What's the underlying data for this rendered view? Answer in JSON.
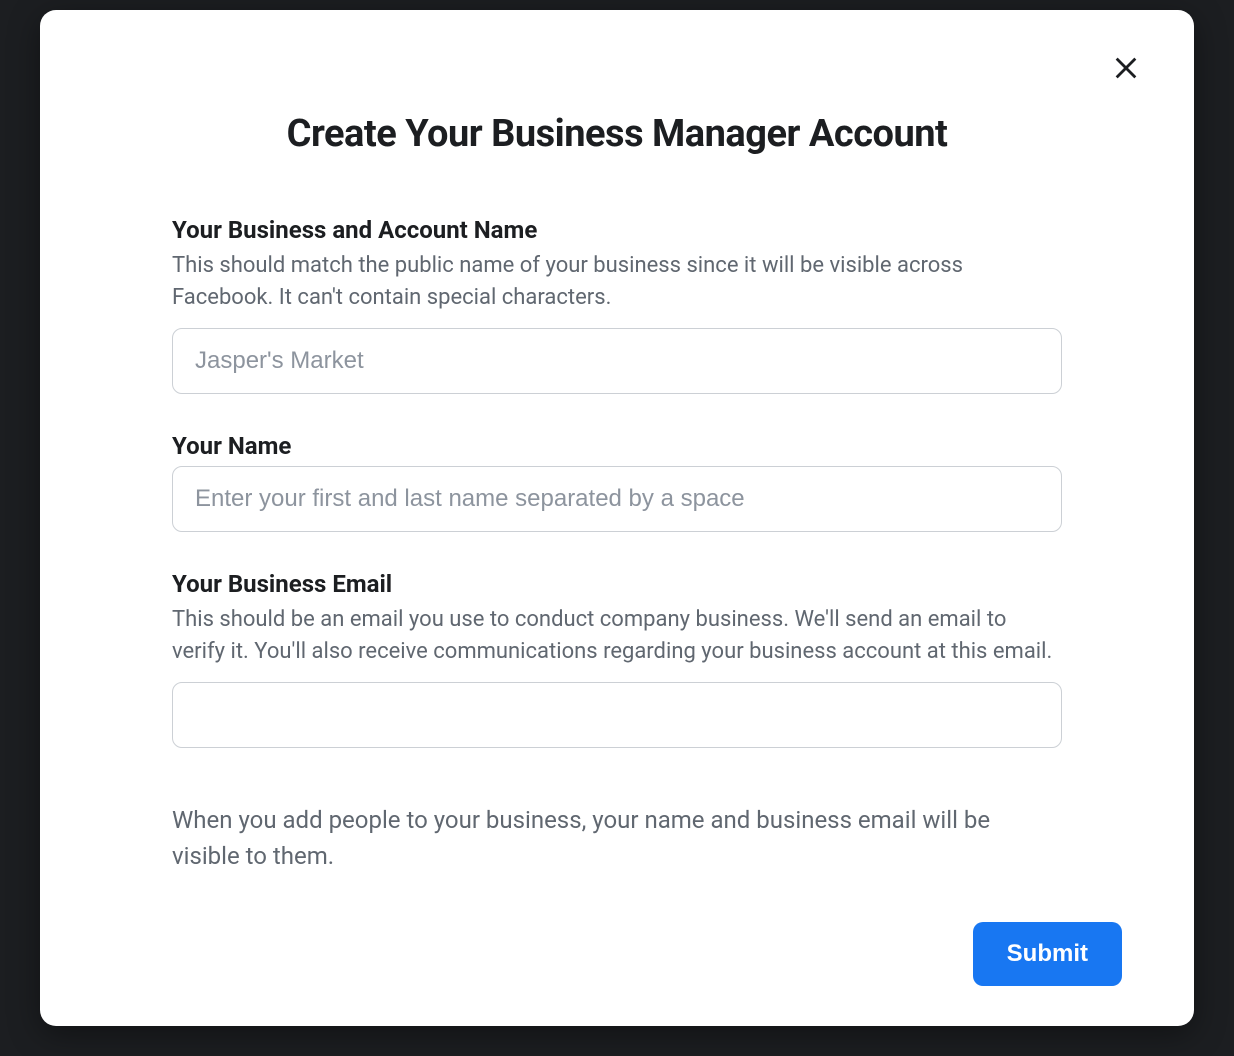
{
  "modal": {
    "title": "Create Your Business Manager Account",
    "close_icon": "close-icon",
    "fields": {
      "business_name": {
        "label": "Your Business and Account Name",
        "description": "This should match the public name of your business since it will be visible across Facebook. It can't contain special characters.",
        "placeholder": "Jasper's Market",
        "value": ""
      },
      "your_name": {
        "label": "Your Name",
        "placeholder": "Enter your first and last name separated by a space",
        "value": ""
      },
      "business_email": {
        "label": "Your Business Email",
        "description": "This should be an email you use to conduct company business. We'll send an email to verify it. You'll also receive communications regarding your business account at this email.",
        "placeholder": "",
        "value": ""
      }
    },
    "info_note": "When you add people to your business, your name and business email will be visible to them.",
    "submit_label": "Submit"
  }
}
